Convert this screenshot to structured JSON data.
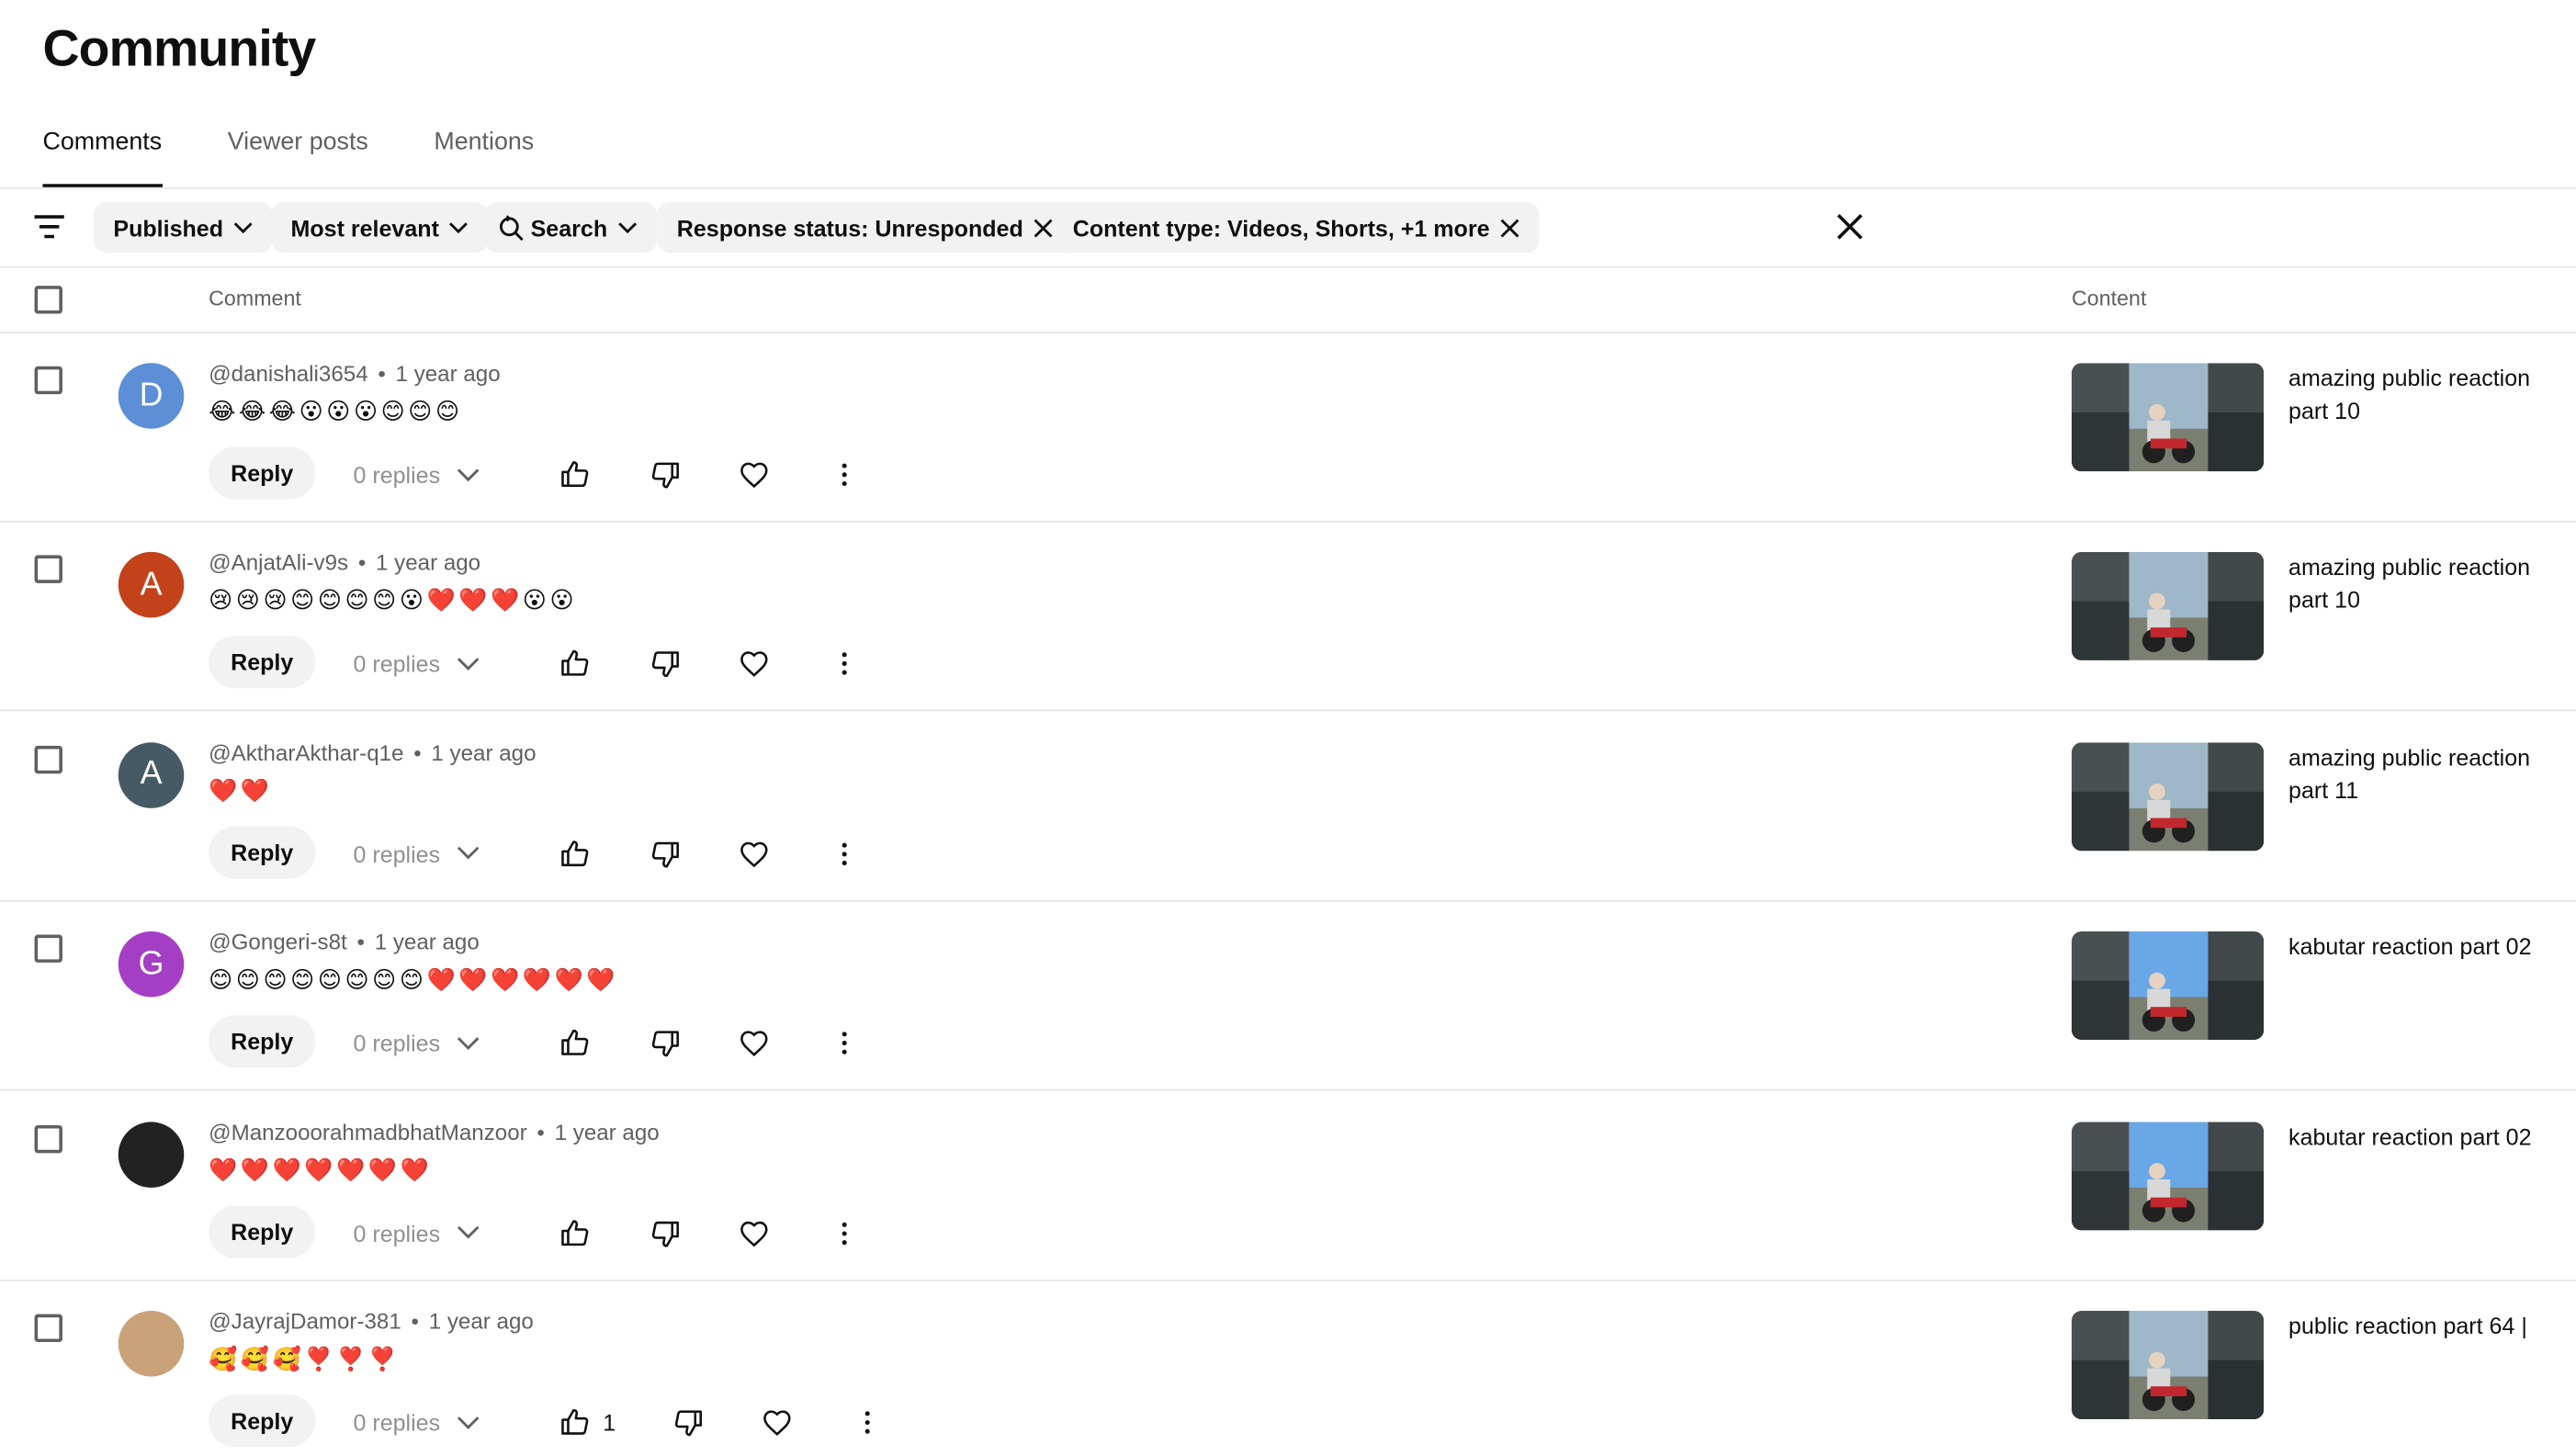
{
  "page_title": "Community",
  "tabs": [
    {
      "label": "Comments",
      "active": true
    },
    {
      "label": "Viewer posts",
      "active": false
    },
    {
      "label": "Mentions",
      "active": false
    }
  ],
  "filters": {
    "published": "Published",
    "sort": "Most relevant",
    "search": "Search",
    "response_status": "Response status: Unresponded",
    "content_type": "Content type: Videos, Shorts, +1 more"
  },
  "columns": {
    "comment": "Comment",
    "content": "Content"
  },
  "reply_label": "Reply",
  "colors": {
    "accent_text": "#0f0f0f",
    "muted": "#606060",
    "chip_bg": "#f2f2f2",
    "heart_red": "#e53935"
  },
  "comments": [
    {
      "author": "@danishali3654",
      "time": "1 year ago",
      "text": "😂😂😂😮😮😮😊😊😊",
      "replies": "0 replies",
      "likes": "",
      "avatar_letter": "D",
      "avatar_color": "#5c8fd6",
      "content_title": "amazing public reaction part 10"
    },
    {
      "author": "@AnjatAli-v9s",
      "time": "1 year ago",
      "text": "😢😢😢😊😊😊😊😮❤️❤️❤️😮😮",
      "replies": "0 replies",
      "likes": "",
      "avatar_letter": "A",
      "avatar_color": "#c4421a",
      "content_title": "amazing public reaction part 10"
    },
    {
      "author": "@AktharAkthar-q1e",
      "time": "1 year ago",
      "text": "❤️❤️",
      "replies": "0 replies",
      "likes": "",
      "avatar_letter": "A",
      "avatar_color": "#455a64",
      "content_title": "amazing public reaction part 11"
    },
    {
      "author": "@Gongeri-s8t",
      "time": "1 year ago",
      "text": "😊😊😊😊😊😊😊😊❤️❤️❤️❤️❤️❤️",
      "replies": "0 replies",
      "likes": "",
      "avatar_letter": "G",
      "avatar_color": "#a43fc5",
      "content_title": "kabutar reaction part 02"
    },
    {
      "author": "@ManzooorahmadbhatManzoor",
      "time": "1 year ago",
      "text": "❤️❤️❤️❤️❤️❤️❤️",
      "replies": "0 replies",
      "likes": "",
      "avatar_letter": "",
      "avatar_color": "#222222",
      "content_title": "kabutar reaction part 02"
    },
    {
      "author": "@JayrajDamor-381",
      "time": "1 year ago",
      "text": "🥰🥰🥰❣️❣️❣️",
      "replies": "0 replies",
      "likes": "1",
      "avatar_letter": "",
      "avatar_color": "#c9a27a",
      "content_title": "public reaction part 64 |"
    }
  ]
}
